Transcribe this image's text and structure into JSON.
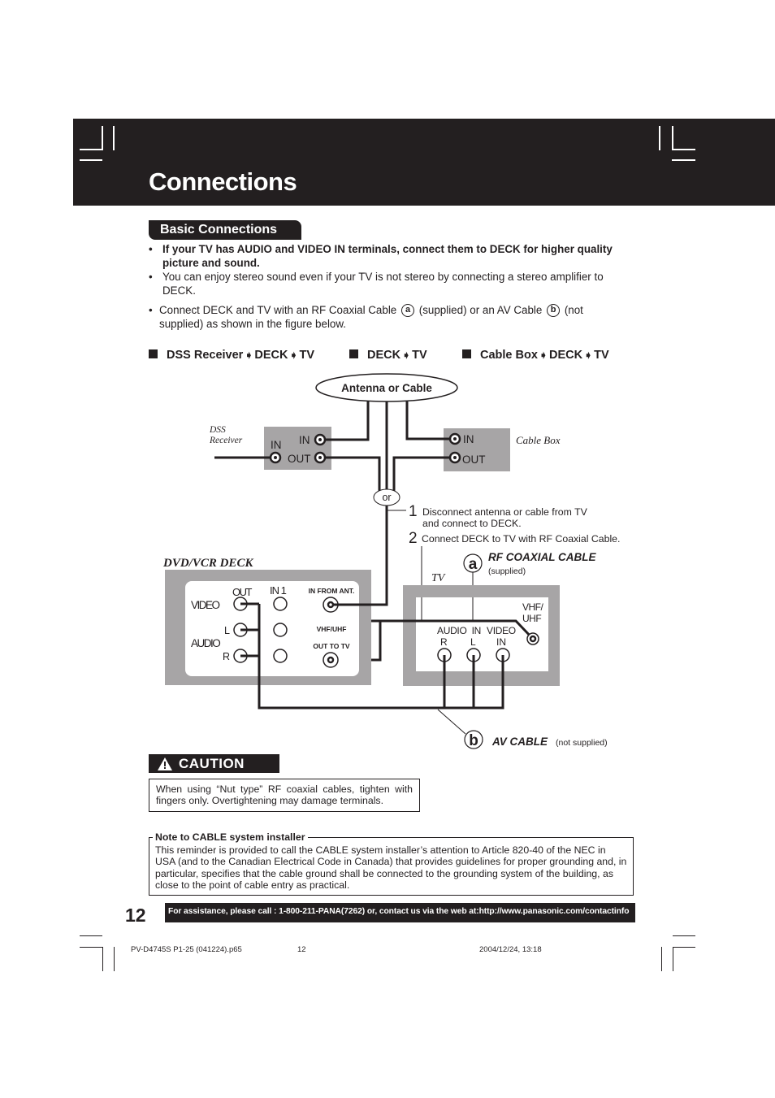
{
  "page": {
    "title": "Connections",
    "section": "Basic Connections",
    "bullets": [
      {
        "text": "If your TV has AUDIO and VIDEO IN terminals, connect them to DECK for higher quality picture and sound.",
        "bold": true
      },
      {
        "text": "You can enjoy stereo sound even if your TV is not stereo by connecting a stereo amplifier to DECK.",
        "bold": false
      }
    ],
    "connect_line": {
      "part1": "Connect DECK and TV with an RF Coaxial Cable",
      "marker_a": "a",
      "part2": "(supplied) or an AV Cable",
      "marker_b": "b",
      "part3": "(not supplied) as shown in the figure below."
    },
    "bullet_glyph": "•",
    "modes": [
      {
        "parts": [
          "DSS Receiver",
          "DECK",
          "TV"
        ]
      },
      {
        "parts": [
          "DECK",
          "TV"
        ]
      },
      {
        "parts": [
          "Cable Box",
          "DECK",
          "TV"
        ]
      }
    ],
    "arrow_glyph": "➧"
  },
  "diagram": {
    "antenna_label": "Antenna or Cable",
    "dss_receiver": {
      "label_line1": "DSS",
      "label_line2": "Receiver",
      "in_left": "IN",
      "in_right": "IN",
      "out": "OUT"
    },
    "cable_box": {
      "label": "Cable Box",
      "in": "IN",
      "out": "OUT"
    },
    "or_label": "or",
    "steps": [
      {
        "num": "1",
        "line1": "Disconnect antenna or cable from TV",
        "line2": "and connect to DECK."
      },
      {
        "num": "2",
        "line1": "Connect DECK to TV with RF Coaxial Cable."
      }
    ],
    "deck": {
      "title": "DVD/VCR DECK",
      "out": "OUT",
      "in1": "IN 1",
      "video": "VIDEO",
      "audio": "AUDIO",
      "l": "L",
      "r": "R",
      "in_from_ant": "IN FROM ANT.",
      "vhf_uhf": "VHF/UHF",
      "out_to_tv": "OUT TO TV"
    },
    "tv": {
      "title": "TV",
      "vhf": "VHF/",
      "uhf": "UHF",
      "audio_in": "AUDIO  IN",
      "video": "VIDEO",
      "r": "R",
      "l": "L",
      "in": "IN"
    },
    "cable_a": {
      "marker": "a",
      "name": "RF COAXIAL CABLE",
      "note": "(supplied)"
    },
    "cable_b": {
      "marker": "b",
      "name": "AV CABLE",
      "note": "(not supplied)"
    }
  },
  "caution": {
    "title": "CAUTION",
    "icon": "warning-icon",
    "text": "When using “Nut type” RF coaxial cables, tighten with fingers only. Overtightening may damage terminals."
  },
  "note": {
    "title": "Note to CABLE system installer",
    "text": "This reminder is provided to call the CABLE system installer’s attention to Article 820-40 of the NEC in USA (and to the Canadian Electrical Code in Canada) that provides guidelines for proper grounding and, in particular, specifies that the cable ground shall be connected to the grounding system of the building, as close to the point of cable entry as practical."
  },
  "footer": {
    "page_number": "12",
    "assistance": "For assistance, please call : 1-800-211-PANA(7262) or, contact us via the web at:http://www.panasonic.com/contactinfo",
    "slug_file": "PV-D4745S P1-25 (041224).p65",
    "slug_page": "12",
    "slug_date": "2004/12/24, 13:18"
  }
}
